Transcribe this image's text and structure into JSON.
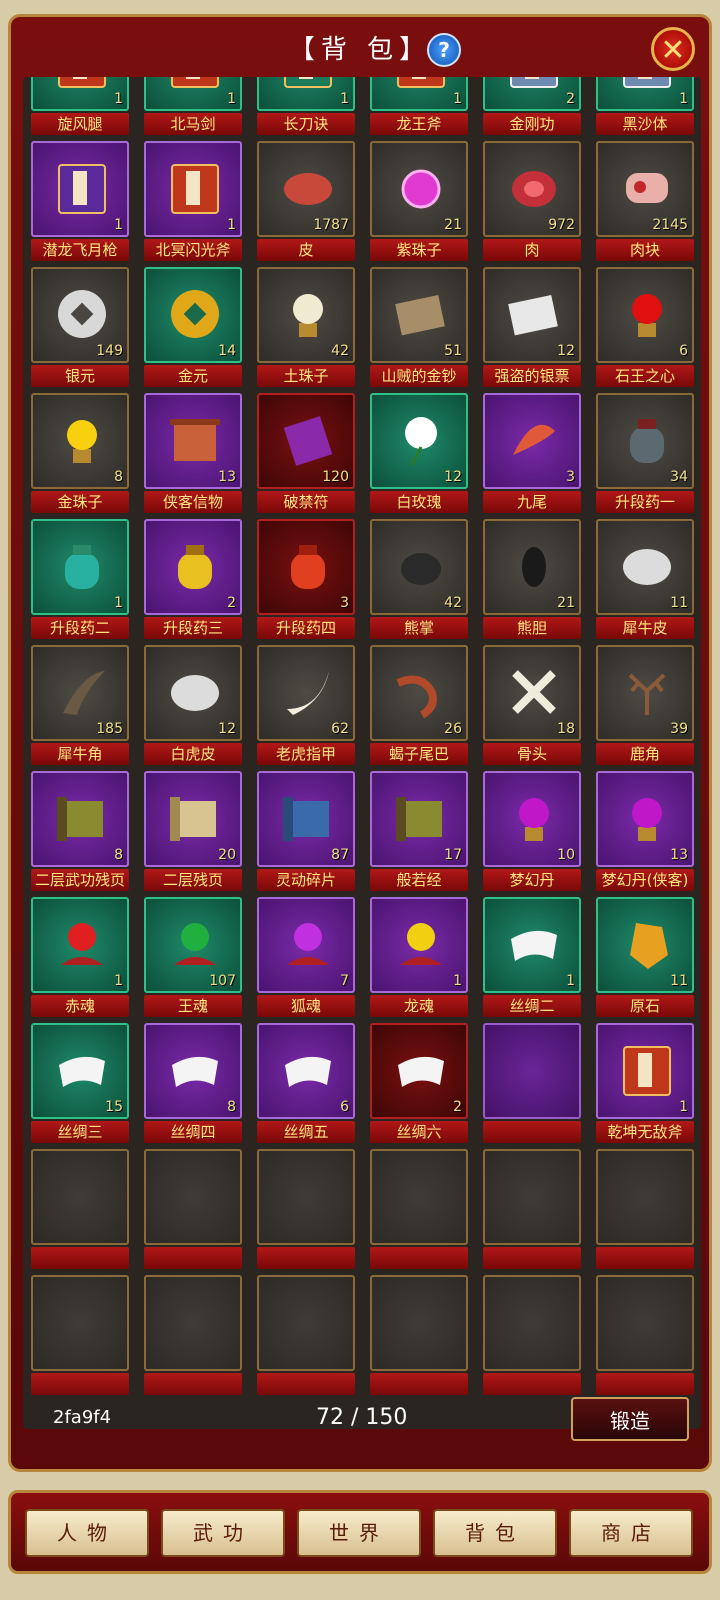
{
  "window": {
    "title": "【背 包】",
    "help": "?",
    "close": "✕"
  },
  "rows": [
    [
      {
        "label": "旋风腿",
        "count": "1",
        "bg": "green",
        "icon": "book-red"
      },
      {
        "label": "北马剑",
        "count": "1",
        "bg": "green",
        "icon": "book-red"
      },
      {
        "label": "长刀诀",
        "count": "1",
        "bg": "green",
        "icon": "book-green"
      },
      {
        "label": "龙王斧",
        "count": "1",
        "bg": "green",
        "icon": "book-red"
      },
      {
        "label": "金刚功",
        "count": "2",
        "bg": "green",
        "icon": "book-blue"
      },
      {
        "label": "黑沙体",
        "count": "1",
        "bg": "green",
        "icon": "book-blue"
      }
    ],
    [
      {
        "label": "潜龙飞月枪",
        "count": "1",
        "bg": "purple",
        "icon": "book-purple"
      },
      {
        "label": "北冥闪光斧",
        "count": "1",
        "bg": "purple",
        "icon": "book-red"
      },
      {
        "label": "皮",
        "count": "1787",
        "bg": "plain",
        "icon": "hide"
      },
      {
        "label": "紫珠子",
        "count": "21",
        "bg": "plain",
        "icon": "pearl-purple"
      },
      {
        "label": "肉",
        "count": "972",
        "bg": "plain",
        "icon": "meat"
      },
      {
        "label": "肉块",
        "count": "2145",
        "bg": "plain",
        "icon": "meat-chunk"
      }
    ],
    [
      {
        "label": "银元",
        "count": "149",
        "bg": "plain",
        "icon": "coin-silver"
      },
      {
        "label": "金元",
        "count": "14",
        "bg": "green",
        "icon": "coin-gold"
      },
      {
        "label": "土珠子",
        "count": "42",
        "bg": "plain",
        "icon": "orb-white"
      },
      {
        "label": "山贼的金钞",
        "count": "51",
        "bg": "plain",
        "icon": "notes"
      },
      {
        "label": "强盗的银票",
        "count": "12",
        "bg": "plain",
        "icon": "notes-white"
      },
      {
        "label": "石王之心",
        "count": "6",
        "bg": "plain",
        "icon": "orb-red"
      }
    ],
    [
      {
        "label": "金珠子",
        "count": "8",
        "bg": "plain",
        "icon": "orb-yellow"
      },
      {
        "label": "侠客信物",
        "count": "13",
        "bg": "purple",
        "icon": "scroll"
      },
      {
        "label": "破禁符",
        "count": "120",
        "bg": "red",
        "icon": "talisman"
      },
      {
        "label": "白玫瑰",
        "count": "12",
        "bg": "green",
        "icon": "rose"
      },
      {
        "label": "九尾",
        "count": "3",
        "bg": "purple",
        "icon": "tail"
      },
      {
        "label": "升段药一",
        "count": "34",
        "bg": "plain",
        "icon": "jar-gray"
      }
    ],
    [
      {
        "label": "升段药二",
        "count": "1",
        "bg": "green",
        "icon": "jar-teal"
      },
      {
        "label": "升段药三",
        "count": "2",
        "bg": "purple",
        "icon": "jar-yellow"
      },
      {
        "label": "升段药四",
        "count": "3",
        "bg": "red",
        "icon": "jar-red"
      },
      {
        "label": "熊掌",
        "count": "42",
        "bg": "plain",
        "icon": "paw"
      },
      {
        "label": "熊胆",
        "count": "21",
        "bg": "plain",
        "icon": "gall"
      },
      {
        "label": "犀牛皮",
        "count": "11",
        "bg": "plain",
        "icon": "fur-white"
      }
    ],
    [
      {
        "label": "犀牛角",
        "count": "185",
        "bg": "plain",
        "icon": "horn"
      },
      {
        "label": "白虎皮",
        "count": "12",
        "bg": "plain",
        "icon": "fur-white"
      },
      {
        "label": "老虎指甲",
        "count": "62",
        "bg": "plain",
        "icon": "claw"
      },
      {
        "label": "蝎子尾巴",
        "count": "26",
        "bg": "plain",
        "icon": "scorpion-tail"
      },
      {
        "label": "骨头",
        "count": "18",
        "bg": "plain",
        "icon": "bone"
      },
      {
        "label": "鹿角",
        "count": "39",
        "bg": "plain",
        "icon": "antler"
      }
    ],
    [
      {
        "label": "二层武功残页",
        "count": "8",
        "bg": "purple",
        "icon": "page-olive"
      },
      {
        "label": "二层残页",
        "count": "20",
        "bg": "purple",
        "icon": "page-tan"
      },
      {
        "label": "灵动碎片",
        "count": "87",
        "bg": "purple",
        "icon": "page-blue"
      },
      {
        "label": "般若经",
        "count": "17",
        "bg": "purple",
        "icon": "page-olive"
      },
      {
        "label": "梦幻丹",
        "count": "10",
        "bg": "purple",
        "icon": "orb-purple"
      },
      {
        "label": "梦幻丹(侠客)",
        "count": "13",
        "bg": "purple",
        "icon": "orb-purple"
      }
    ],
    [
      {
        "label": "赤魂",
        "count": "1",
        "bg": "green",
        "icon": "soul-red"
      },
      {
        "label": "王魂",
        "count": "107",
        "bg": "green",
        "icon": "soul-green"
      },
      {
        "label": "狐魂",
        "count": "7",
        "bg": "purple",
        "icon": "soul-purple"
      },
      {
        "label": "龙魂",
        "count": "1",
        "bg": "purple",
        "icon": "soul-yellow"
      },
      {
        "label": "丝绸二",
        "count": "1",
        "bg": "green",
        "icon": "silk"
      },
      {
        "label": "原石",
        "count": "11",
        "bg": "green",
        "icon": "ore"
      }
    ],
    [
      {
        "label": "丝绸三",
        "count": "15",
        "bg": "green",
        "icon": "silk"
      },
      {
        "label": "丝绸四",
        "count": "8",
        "bg": "purple",
        "icon": "silk"
      },
      {
        "label": "丝绸五",
        "count": "6",
        "bg": "purple",
        "icon": "silk"
      },
      {
        "label": "丝绸六",
        "count": "2",
        "bg": "red",
        "icon": "silk"
      },
      {
        "label": "",
        "count": "",
        "bg": "empty-purple",
        "icon": ""
      },
      {
        "label": "乾坤无敌斧",
        "count": "1",
        "bg": "purple",
        "icon": "book-red"
      }
    ],
    [
      {
        "label": "",
        "count": "",
        "bg": "empty",
        "icon": ""
      },
      {
        "label": "",
        "count": "",
        "bg": "empty",
        "icon": ""
      },
      {
        "label": "",
        "count": "",
        "bg": "empty",
        "icon": ""
      },
      {
        "label": "",
        "count": "",
        "bg": "empty",
        "icon": ""
      },
      {
        "label": "",
        "count": "",
        "bg": "empty",
        "icon": ""
      },
      {
        "label": "",
        "count": "",
        "bg": "empty",
        "icon": ""
      }
    ],
    [
      {
        "label": "",
        "count": "",
        "bg": "empty",
        "icon": ""
      },
      {
        "label": "",
        "count": "",
        "bg": "empty",
        "icon": ""
      },
      {
        "label": "",
        "count": "",
        "bg": "empty",
        "icon": ""
      },
      {
        "label": "",
        "count": "",
        "bg": "empty",
        "icon": ""
      },
      {
        "label": "",
        "count": "",
        "bg": "empty",
        "icon": ""
      },
      {
        "label": "",
        "count": "",
        "bg": "empty",
        "icon": ""
      }
    ]
  ],
  "footer": {
    "code": "2fa9f4",
    "capacity": "72 / 150",
    "forge": "锻造"
  },
  "nav": [
    "人物",
    "武功",
    "世界",
    "背包",
    "商店"
  ]
}
